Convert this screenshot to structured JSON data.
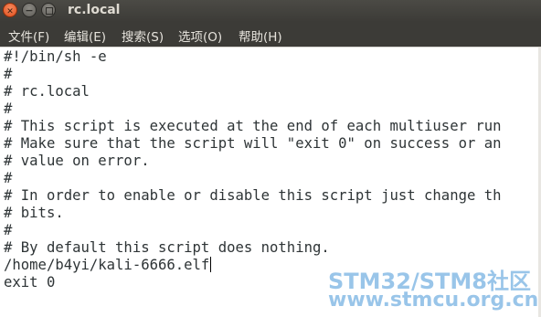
{
  "window": {
    "title": "rc.local",
    "buttons": {
      "close_icon": "✕",
      "minimize_icon": "−"
    }
  },
  "menu": {
    "items": [
      "文件(F)",
      "编辑(E)",
      "搜索(S)",
      "选项(O)",
      "帮助(H)"
    ]
  },
  "editor": {
    "lines": [
      "#!/bin/sh -e",
      "#",
      "# rc.local",
      "#",
      "# This script is executed at the end of each multiuser run",
      "# Make sure that the script will \"exit 0\" on success or an",
      "# value on error.",
      "#",
      "# In order to enable or disable this script just change th",
      "# bits.",
      "#",
      "# By default this script does nothing.",
      "/home/b4yi/kali-6666.elf",
      "exit 0"
    ],
    "caret_line": 13
  },
  "watermark": {
    "line1": "STM32/STM8社区",
    "line2": "www.stmcu.org.cn"
  },
  "colors": {
    "titlebar": "#3c3b37",
    "close_button": "#e04e1c",
    "text": "#2e3436",
    "watermark": "#4696d7"
  }
}
